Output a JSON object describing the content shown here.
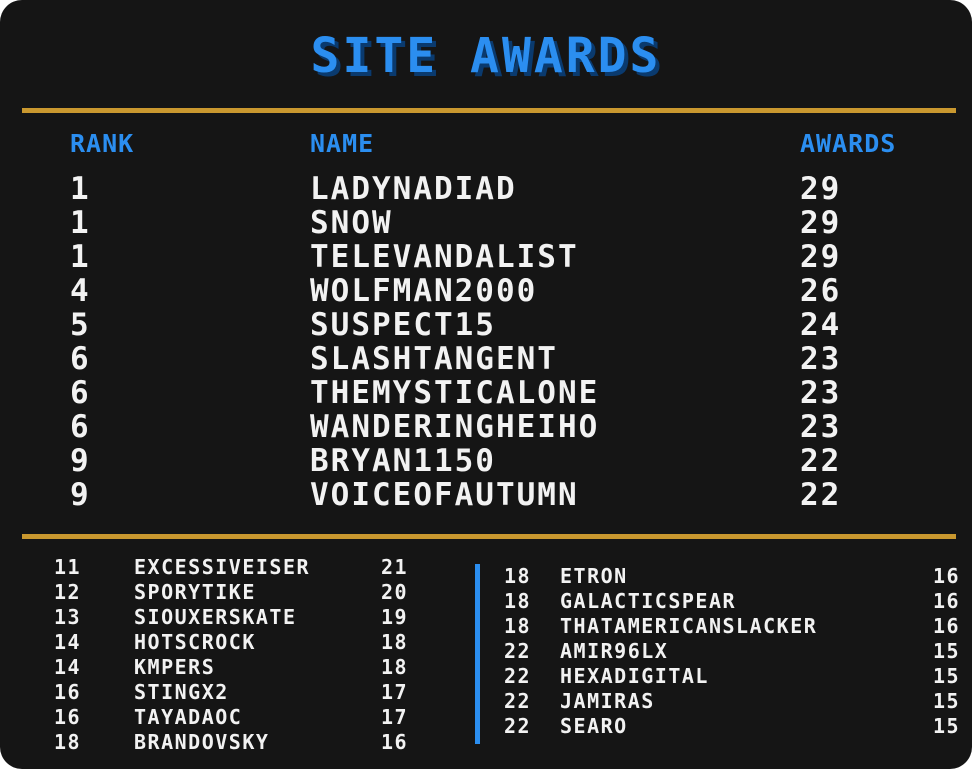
{
  "title": "SITE AWARDS",
  "colors": {
    "background": "#151515",
    "accent_blue": "#2b8ef0",
    "rule_gold": "#c9982f",
    "text": "#f2f2f2"
  },
  "headers": {
    "rank": "RANK",
    "name": "NAME",
    "awards": "AWARDS"
  },
  "top_ten": [
    {
      "rank": "1",
      "name": "LADYNADIAD",
      "awards": "29"
    },
    {
      "rank": "1",
      "name": "SNOW",
      "awards": "29"
    },
    {
      "rank": "1",
      "name": "TELEVANDALIST",
      "awards": "29"
    },
    {
      "rank": "4",
      "name": "WOLFMAN2000",
      "awards": "26"
    },
    {
      "rank": "5",
      "name": "SUSPECT15",
      "awards": "24"
    },
    {
      "rank": "6",
      "name": "SLASHTANGENT",
      "awards": "23"
    },
    {
      "rank": "6",
      "name": "THEMYSTICALONE",
      "awards": "23"
    },
    {
      "rank": "6",
      "name": "WANDERINGHEIHO",
      "awards": "23"
    },
    {
      "rank": "9",
      "name": "BRYAN1150",
      "awards": "22"
    },
    {
      "rank": "9",
      "name": "VOICEOFAUTUMN",
      "awards": "22"
    }
  ],
  "left_list": [
    {
      "rank": "11",
      "name": "EXCESSIVEISER",
      "awards": "21"
    },
    {
      "rank": "12",
      "name": "SPORYTIKE",
      "awards": "20"
    },
    {
      "rank": "13",
      "name": "SIOUXERSKATE",
      "awards": "19"
    },
    {
      "rank": "14",
      "name": "HOTSCROCK",
      "awards": "18"
    },
    {
      "rank": "14",
      "name": "KMPERS",
      "awards": "18"
    },
    {
      "rank": "16",
      "name": "STINGX2",
      "awards": "17"
    },
    {
      "rank": "16",
      "name": "TAYADAOC",
      "awards": "17"
    },
    {
      "rank": "18",
      "name": "BRANDOVSKY",
      "awards": "16"
    }
  ],
  "right_list": [
    {
      "rank": "18",
      "name": "ETRON",
      "awards": "16"
    },
    {
      "rank": "18",
      "name": "GALACTICSPEAR",
      "awards": "16"
    },
    {
      "rank": "18",
      "name": "THATAMERICANSLACKER",
      "awards": "16"
    },
    {
      "rank": "22",
      "name": "AMIR96LX",
      "awards": "15"
    },
    {
      "rank": "22",
      "name": "HEXADIGITAL",
      "awards": "15"
    },
    {
      "rank": "22",
      "name": "JAMIRAS",
      "awards": "15"
    },
    {
      "rank": "22",
      "name": "SEARO",
      "awards": "15"
    }
  ]
}
